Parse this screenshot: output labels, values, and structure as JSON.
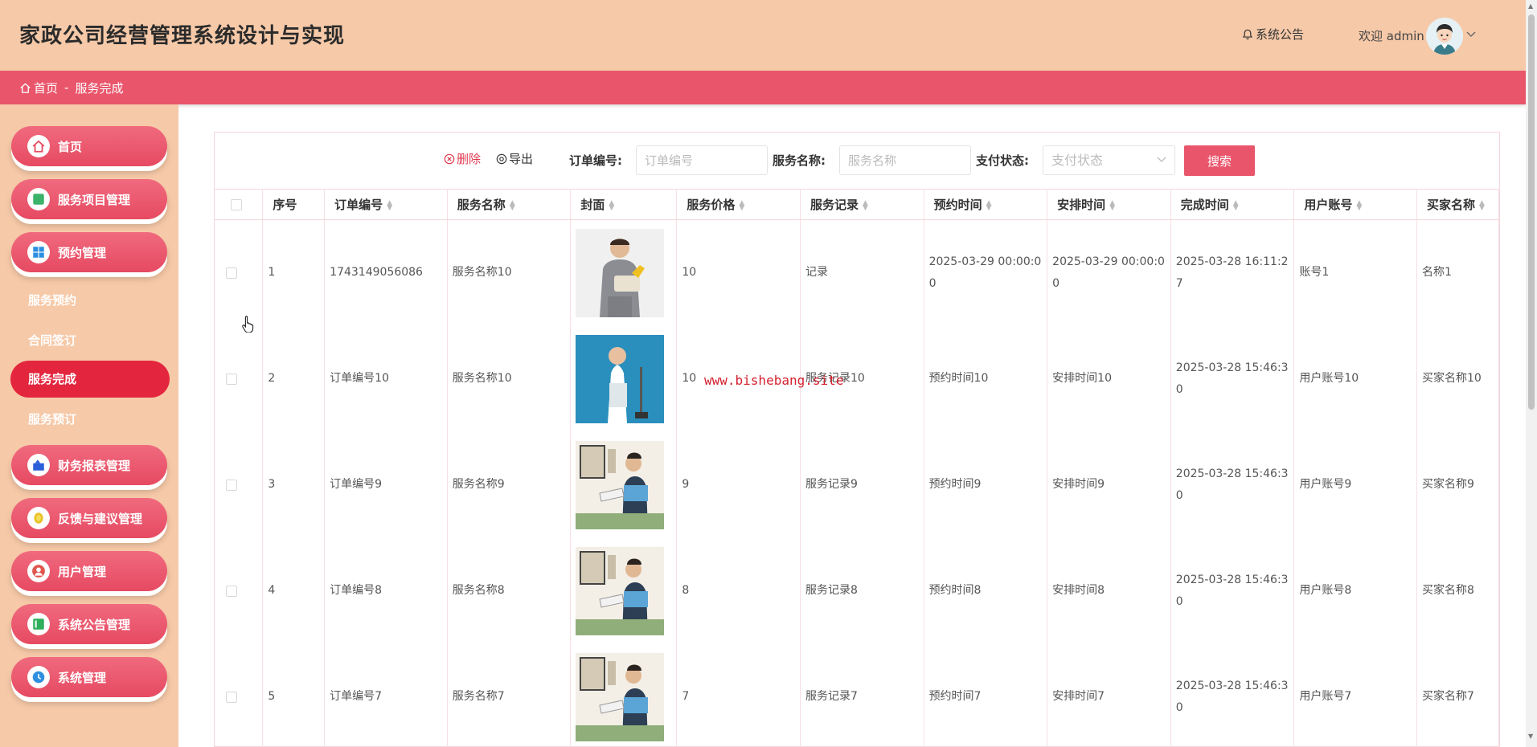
{
  "header": {
    "title": "家政公司经营管理系统设计与实现",
    "notice_label": "系统公告",
    "welcome_label": "欢迎 admin"
  },
  "breadcrumb": {
    "home": "首页",
    "separator": "-",
    "current": "服务完成"
  },
  "sidebar": {
    "items": [
      {
        "label": "首页",
        "icon": "home-icon"
      },
      {
        "label": "服务项目管理",
        "icon": "green-square-icon"
      },
      {
        "label": "预约管理",
        "icon": "windows-grid-icon"
      },
      {
        "label": "财务报表管理",
        "icon": "chart-icon"
      },
      {
        "label": "反馈与建议管理",
        "icon": "coin-icon"
      },
      {
        "label": "用户管理",
        "icon": "user-icon"
      },
      {
        "label": "系统公告管理",
        "icon": "notice-icon"
      },
      {
        "label": "系统管理",
        "icon": "settings-icon"
      }
    ],
    "sub_items": [
      "服务预约",
      "合同签订",
      "服务完成",
      "服务预订"
    ],
    "active_sub": "服务完成"
  },
  "toolbar": {
    "delete_label": "删除",
    "export_label": "导出",
    "order_label": "订单编号:",
    "order_placeholder": "订单编号",
    "service_label": "服务名称:",
    "service_placeholder": "服务名称",
    "pay_label": "支付状态:",
    "pay_placeholder": "支付状态",
    "search_label": "搜索"
  },
  "table": {
    "columns": [
      "序号",
      "订单编号",
      "服务名称",
      "封面",
      "服务价格",
      "服务记录",
      "预约时间",
      "安排时间",
      "完成时间",
      "用户账号",
      "买家名称"
    ],
    "rows": [
      {
        "index": "1",
        "order": "1743149056086",
        "service": "服务名称10",
        "price": "10",
        "record": "记录",
        "reserve": "2025-03-29 00:00:00",
        "arrange": "2025-03-29 00:00:00",
        "done": "2025-03-28 16:11:27",
        "account": "账号1",
        "buyer": "名称1"
      },
      {
        "index": "2",
        "order": "订单编号10",
        "service": "服务名称10",
        "price": "10",
        "record": "服务记录10",
        "reserve": "预约时间10",
        "arrange": "安排时间10",
        "done": "2025-03-28 15:46:30",
        "account": "用户账号10",
        "buyer": "买家名称10"
      },
      {
        "index": "3",
        "order": "订单编号9",
        "service": "服务名称9",
        "price": "9",
        "record": "服务记录9",
        "reserve": "预约时间9",
        "arrange": "安排时间9",
        "done": "2025-03-28 15:46:30",
        "account": "用户账号9",
        "buyer": "买家名称9"
      },
      {
        "index": "4",
        "order": "订单编号8",
        "service": "服务名称8",
        "price": "8",
        "record": "服务记录8",
        "reserve": "预约时间8",
        "arrange": "安排时间8",
        "done": "2025-03-28 15:46:30",
        "account": "用户账号8",
        "buyer": "买家名称8"
      },
      {
        "index": "5",
        "order": "订单编号7",
        "service": "服务名称7",
        "price": "7",
        "record": "服务记录7",
        "reserve": "预约时间7",
        "arrange": "安排时间7",
        "done": "2025-03-28 15:46:30",
        "account": "用户账号7",
        "buyer": "买家名称7"
      }
    ]
  },
  "watermark": "www.bishebang.site",
  "colors": {
    "header_bg": "#f6c9a8",
    "accent": "#e9566c",
    "active": "#e3263e"
  }
}
